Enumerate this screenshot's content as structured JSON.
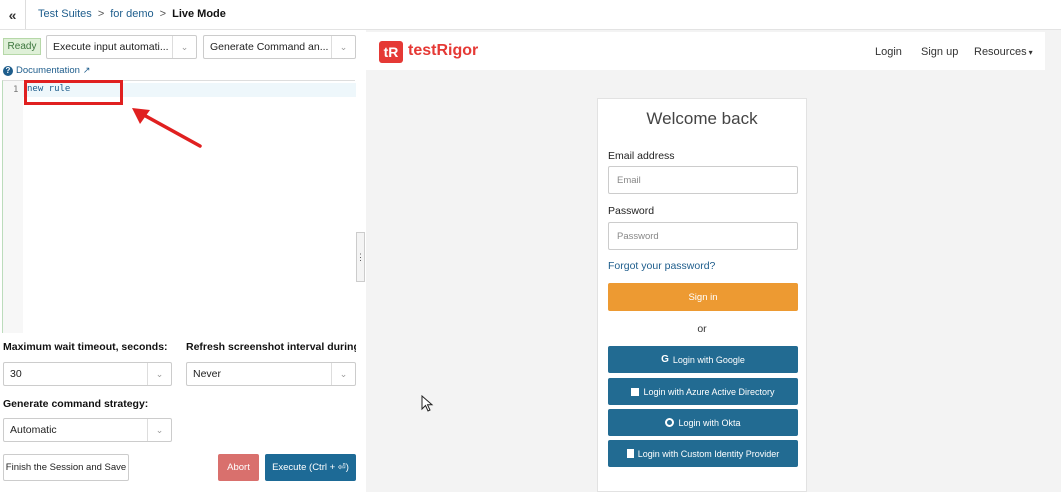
{
  "topbar": {
    "collapse_icon": "«",
    "breadcrumb": [
      {
        "label": "Test Suites",
        "link": true
      },
      {
        "label": "for demo",
        "link": true
      },
      {
        "label": "Live Mode",
        "link": false
      }
    ],
    "separator": ">"
  },
  "left_panel": {
    "status": "Ready",
    "mode_select": "Execute input automati...",
    "generate_select": "Generate Command an...",
    "documentation_link": "Documentation",
    "editor": {
      "line_number": "1",
      "code": "new rule"
    },
    "max_wait_label": "Maximum wait timeout, seconds:",
    "max_wait_value": "30",
    "refresh_label": "Refresh screenshot interval during i...",
    "refresh_value": "Never",
    "strategy_label": "Generate command strategy:",
    "strategy_value": "Automatic",
    "finish_button": "Finish the Session and Save",
    "abort_button": "Abort",
    "execute_button": "Execute (Ctrl + ⏎)"
  },
  "preview": {
    "logo_mark": "tR",
    "logo_text": "testRigor",
    "nav": {
      "login": "Login",
      "signup": "Sign up",
      "resources": "Resources"
    },
    "card": {
      "title": "Welcome back",
      "email_label": "Email address",
      "email_placeholder": "Email",
      "password_label": "Password",
      "password_placeholder": "Password",
      "forgot": "Forgot your password?",
      "signin": "Sign in",
      "or": "or",
      "google": "Login with Google",
      "azure": "Login with Azure Active Directory",
      "okta": "Login with Okta",
      "custom": "Login with Custom Identity Provider"
    }
  },
  "colors": {
    "link": "#1e5d8c",
    "brand_red": "#e53935",
    "signin_orange": "#ed9a32",
    "sso_blue": "#226b92",
    "execute_blue": "#1d6a96",
    "abort_red": "#d9706d",
    "annotation_red": "#e02020"
  }
}
